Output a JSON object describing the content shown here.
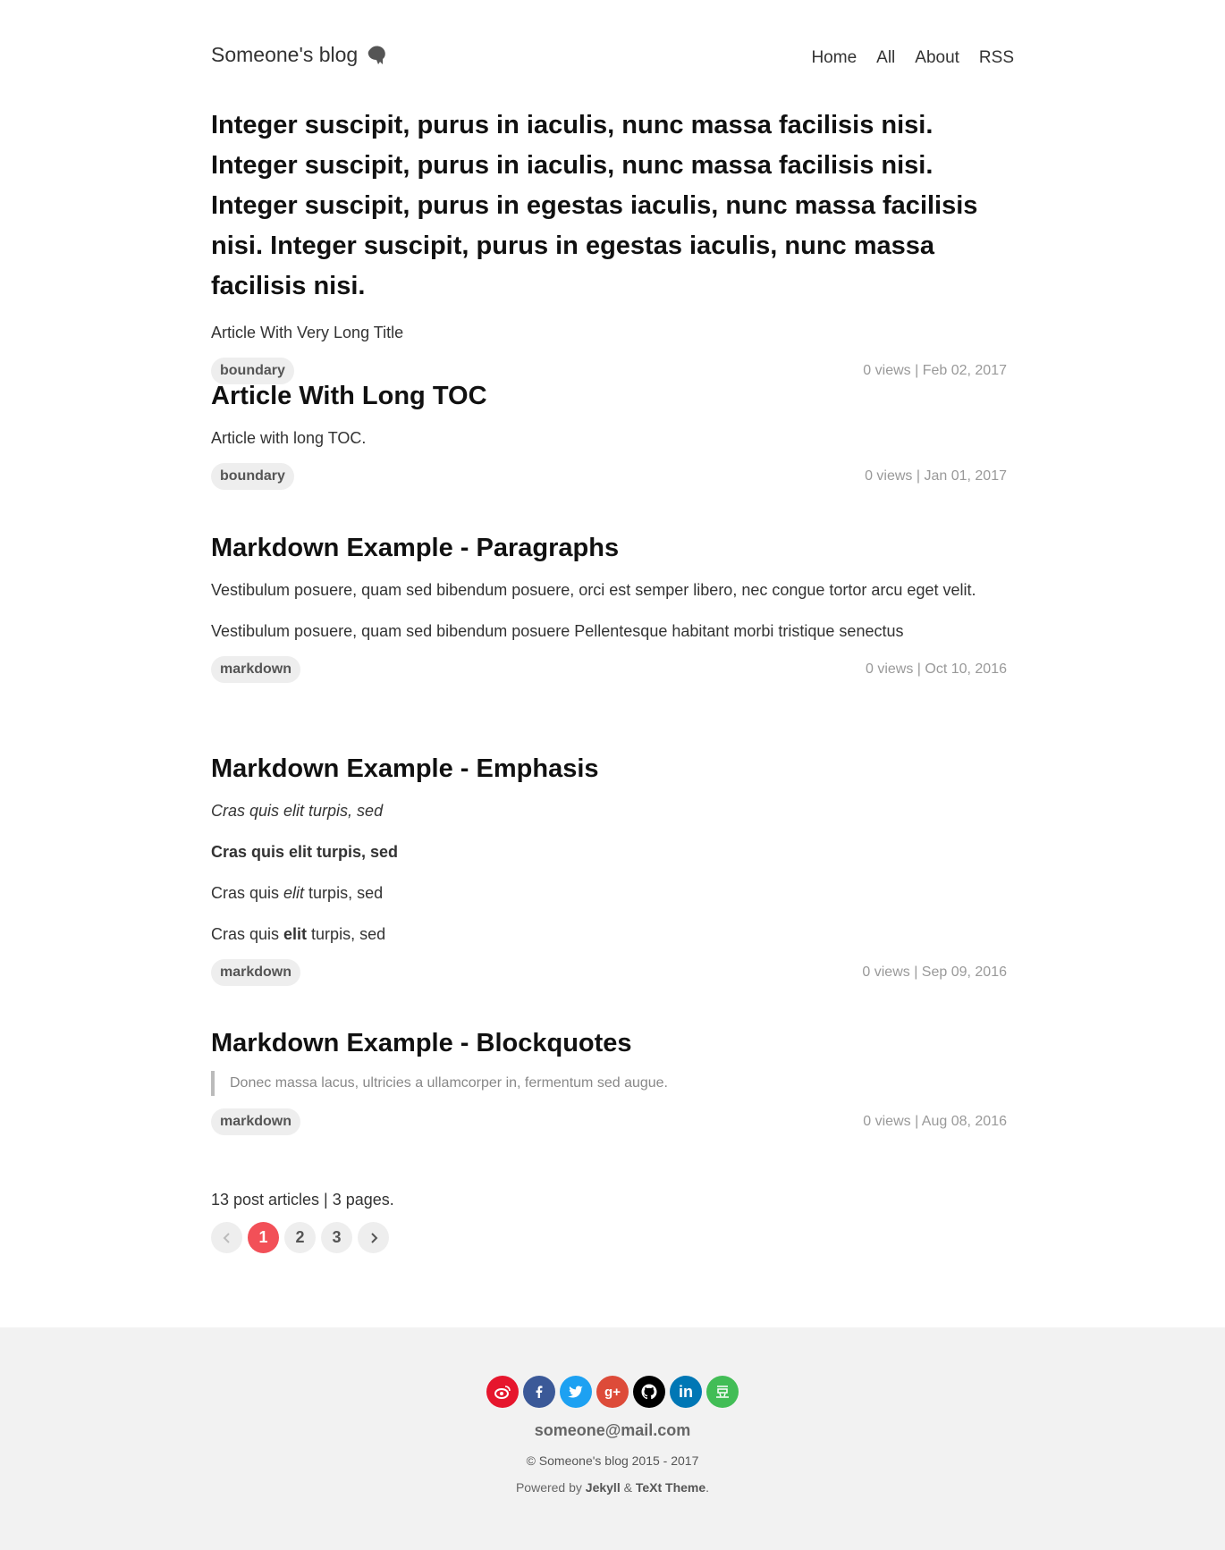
{
  "header": {
    "site_title": "Someone's blog",
    "nav": [
      "Home",
      "All",
      "About",
      "RSS"
    ]
  },
  "articles": [
    {
      "title": "Integer suscipit, purus in iaculis, nunc massa facilisis nisi. Integer suscipit, purus in iaculis, nunc massa facilisis nisi. Integer suscipit, purus in egestas iaculis, nunc massa facilisis nisi. Integer suscipit, purus in egestas iaculis, nunc massa facilisis nisi.",
      "excerpt": "Article With Very Long Title",
      "tag": "boundary",
      "meta": "0 views | Feb 02, 2017"
    },
    {
      "title": "Article With Long TOC",
      "excerpt": "Article with long TOC.",
      "tag": "boundary",
      "meta": "0 views | Jan 01, 2017"
    },
    {
      "title": "Markdown Example - Paragraphs",
      "excerpt": "Vestibulum posuere, quam sed bibendum posuere, orci est semper libero, nec congue tortor arcu eget velit.",
      "excerpt2": "Vestibulum posuere, quam sed bibendum posuere Pellentesque habitant morbi tristique senectus",
      "tag": "markdown",
      "meta": "0 views | Oct 10, 2016"
    },
    {
      "title": "Markdown Example - Emphasis",
      "lines": [
        "Cras quis elit turpis, sed",
        "Cras quis elit turpis, sed"
      ],
      "line3": {
        "a": "Cras quis ",
        "b": "elit",
        "c": " turpis, sed"
      },
      "line4": {
        "a": "Cras quis ",
        "b": "elit",
        "c": " turpis, sed"
      },
      "tag": "markdown",
      "meta": "0 views | Sep 09, 2016"
    },
    {
      "title": "Markdown Example - Blockquotes",
      "quote": "Donec massa lacus, ultricies a ullamcorper in, fermentum sed augue.",
      "tag": "markdown",
      "meta": "0 views | Aug 08, 2016"
    }
  ],
  "pagination": {
    "info": "13 post articles | 3 pages.",
    "pages": [
      "1",
      "2",
      "3"
    ],
    "active": "1"
  },
  "footer": {
    "social": [
      {
        "name": "weibo-icon",
        "color": "#e6162d"
      },
      {
        "name": "facebook-icon",
        "color": "#3b5998"
      },
      {
        "name": "twitter-icon",
        "color": "#1da1f2"
      },
      {
        "name": "google-plus-icon",
        "color": "#dd4b39"
      },
      {
        "name": "github-icon",
        "color": "#000000"
      },
      {
        "name": "linkedin-icon",
        "color": "#0077b5"
      },
      {
        "name": "douban-icon",
        "color": "#42bd56"
      }
    ],
    "email": "someone@mail.com",
    "copyright": "© Someone's blog 2015 - 2017",
    "powered_prefix": "Powered by ",
    "powered_jekyll": "Jekyll",
    "powered_amp": " & ",
    "powered_theme": "TeXt Theme",
    "powered_suffix": "."
  }
}
